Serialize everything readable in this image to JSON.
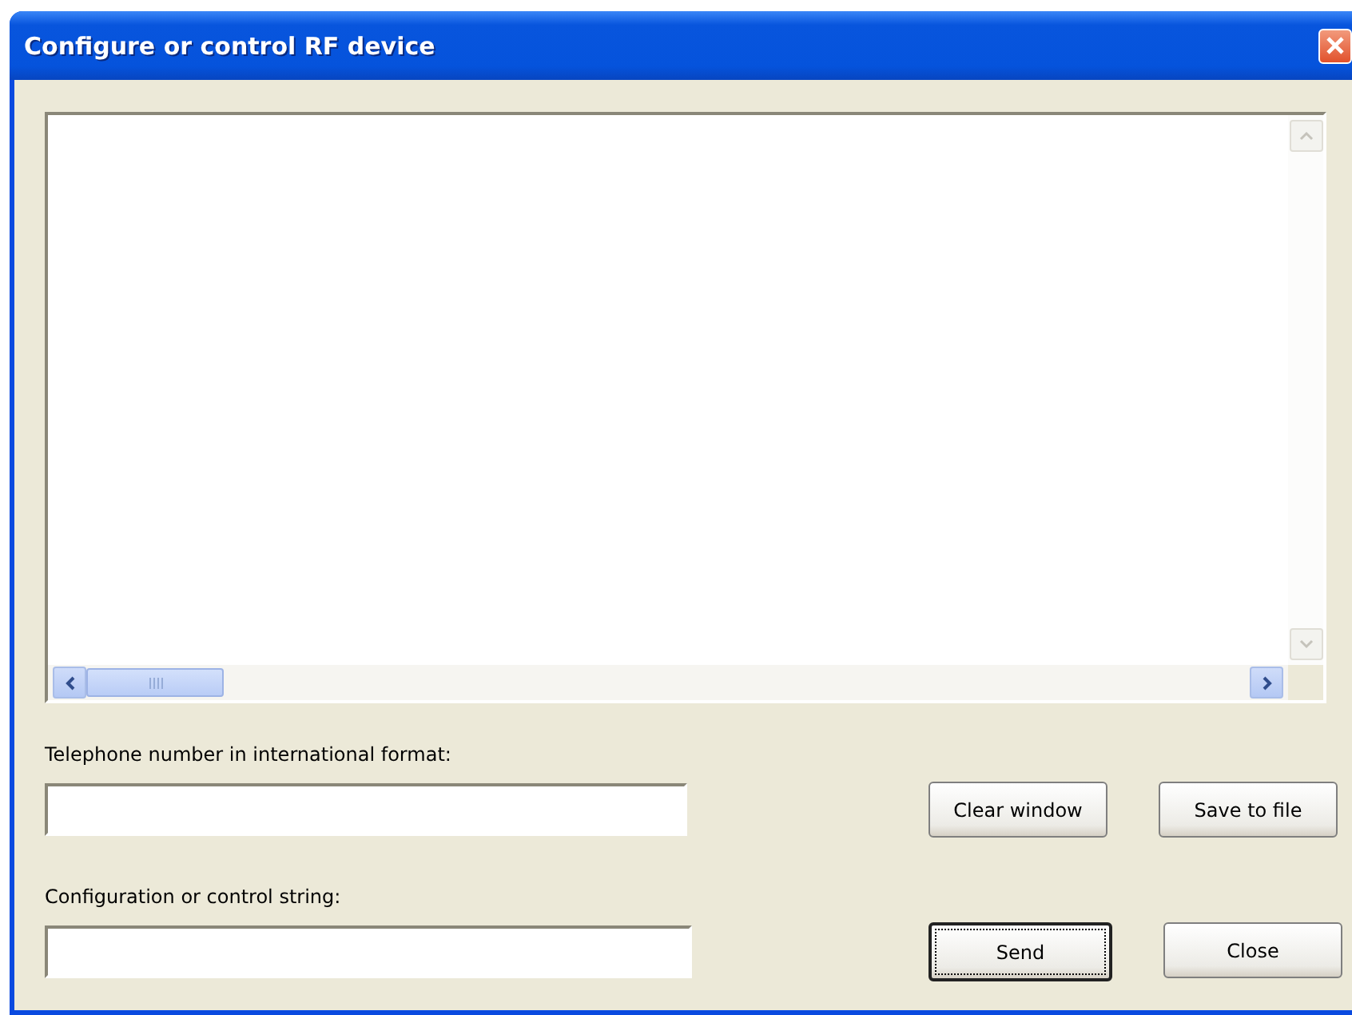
{
  "window": {
    "title": "Configure or control RF device"
  },
  "fields": [
    {
      "label": "Telephone number in international format:"
    },
    {
      "label": "Configuration or control string:"
    }
  ],
  "buttons": [
    [
      {
        "label": "Clear window",
        "focused": false
      },
      {
        "label": "Save to file",
        "focused": false
      }
    ],
    [
      {
        "label": "Send",
        "focused": true
      },
      {
        "label": "Close",
        "focused": false
      }
    ]
  ]
}
